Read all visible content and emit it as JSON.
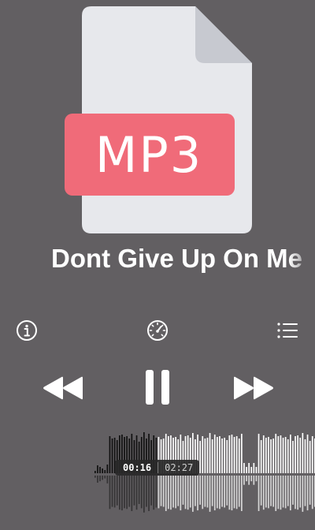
{
  "artwork": {
    "file_label": "MP3",
    "icon": "mp3-file-icon",
    "colors": {
      "paper": "#e7e8ec",
      "fold": "#c7c9d0",
      "label": "#f06b79"
    }
  },
  "track": {
    "title": "Dont Give Up On Me"
  },
  "toolbar": {
    "info_icon": "info-circle-icon",
    "speed_icon": "speedometer-icon",
    "list_icon": "list-icon"
  },
  "controls": {
    "rewind_icon": "rewind-icon",
    "pause_icon": "pause-icon",
    "forward_icon": "fast-forward-icon"
  },
  "playback": {
    "current_time": "00:16",
    "total_time": "02:27",
    "progress": 0.109
  },
  "colors": {
    "background": "#625f62",
    "played_wave": "#111111",
    "unplayed_wave": "#ffffff"
  }
}
